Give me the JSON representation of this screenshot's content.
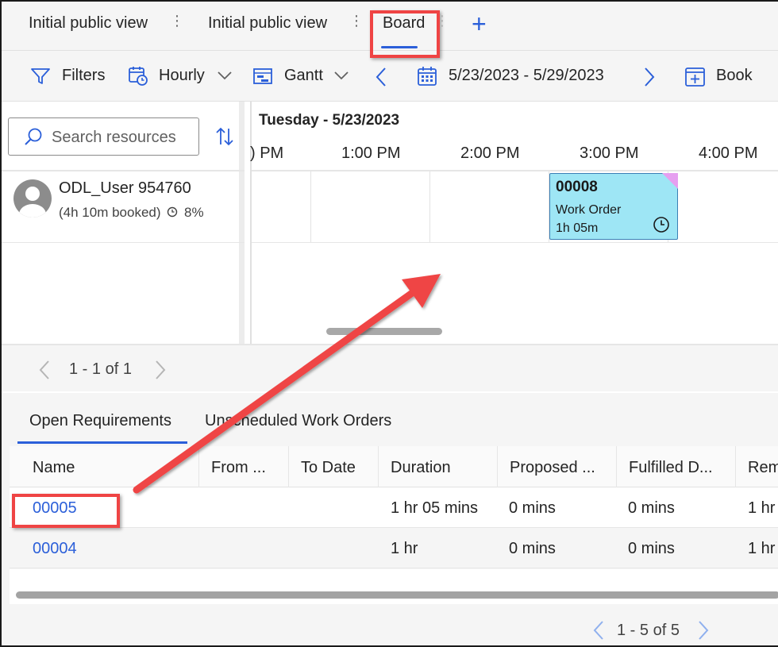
{
  "tabs": [
    {
      "label": "Initial public view"
    },
    {
      "label": "Initial public view"
    },
    {
      "label": "Board"
    }
  ],
  "tab_more_glyph": "⋮",
  "add_tab_glyph": "+",
  "toolbar": {
    "filters_label": "Filters",
    "resolution_label": "Hourly",
    "view_label": "Gantt",
    "date_range": "5/23/2023 - 5/29/2023",
    "book_label": "Book"
  },
  "resources": {
    "search_placeholder": "Search resources",
    "items": [
      {
        "name": "ODL_User 954760",
        "booked": "(4h 10m booked)",
        "utilization": "8%"
      }
    ]
  },
  "schedule": {
    "date_heading": "Tuesday - 5/23/2023",
    "time_slots": [
      ") PM",
      "1:00 PM",
      "2:00 PM",
      "3:00 PM",
      "4:00 PM"
    ],
    "booking": {
      "id": "00008",
      "type": "Work Order",
      "duration": "1h 05m",
      "color": "#9ee6f5",
      "status_color": "#e69ff0"
    }
  },
  "resource_pager": {
    "text": "1 - 1 of 1"
  },
  "requirements": {
    "tabs": [
      {
        "label": "Open Requirements",
        "active": true
      },
      {
        "label": "Unscheduled Work Orders",
        "active": false
      }
    ],
    "columns": [
      "Name",
      "From ...",
      "To Date",
      "Duration",
      "Proposed ...",
      "Fulfilled D...",
      "Rem"
    ],
    "rows": [
      {
        "name": "00005",
        "from": "",
        "to": "",
        "duration": "1 hr 05 mins",
        "proposed": "0 mins",
        "fulfilled": "0 mins",
        "remaining": "1 hr"
      },
      {
        "name": "00004",
        "from": "",
        "to": "",
        "duration": "1 hr",
        "proposed": "0 mins",
        "fulfilled": "0 mins",
        "remaining": "1 hr"
      }
    ],
    "pager": {
      "text": "1 - 5 of 5"
    }
  },
  "colors": {
    "accent": "#2b5fd9",
    "annotation": "#ef4444"
  }
}
